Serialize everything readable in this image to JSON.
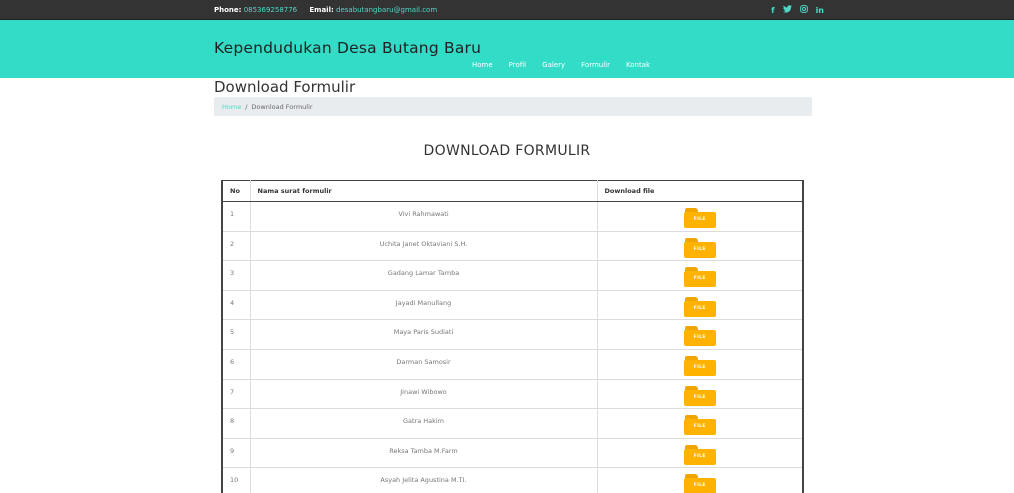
{
  "topbar": {
    "phone_label": "Phone:",
    "phone": "085369258776",
    "email_label": "Email:",
    "email": "desabutangbaru@gmail.com",
    "social": [
      "f",
      "★",
      "◎",
      "in"
    ]
  },
  "header": {
    "site_title": "Kependudukan Desa Butang Baru",
    "nav": [
      "Home",
      "Profil",
      "Galery",
      "Formulir",
      "Kontak"
    ]
  },
  "page": {
    "heading": "Download Formulir",
    "breadcrumb": {
      "home": "Home",
      "separator": "/",
      "current": "Download Formulir"
    },
    "section_title": "DOWNLOAD FORMULIR"
  },
  "table": {
    "headers": [
      "No",
      "Nama surat formulir",
      "Download file"
    ],
    "file_label": "FILE",
    "rows": [
      {
        "no": "1",
        "name": "Vivi Rahmawati"
      },
      {
        "no": "2",
        "name": "Uchita Janet Oktaviani S.H."
      },
      {
        "no": "3",
        "name": "Gadang Lamar Tamba"
      },
      {
        "no": "4",
        "name": "Jayadi Manullang"
      },
      {
        "no": "5",
        "name": "Maya Paris Sudiati"
      },
      {
        "no": "6",
        "name": "Darman Samosir"
      },
      {
        "no": "7",
        "name": "Jinawi Wibowo"
      },
      {
        "no": "8",
        "name": "Gatra Hakim"
      },
      {
        "no": "9",
        "name": "Reksa Tamba M.Farm"
      },
      {
        "no": "10",
        "name": "Asyah Jelita Agustina M.TI."
      }
    ]
  },
  "colors": {
    "accent": "#33dcc7",
    "topbar": "#333333",
    "folder": "#ffb300"
  }
}
